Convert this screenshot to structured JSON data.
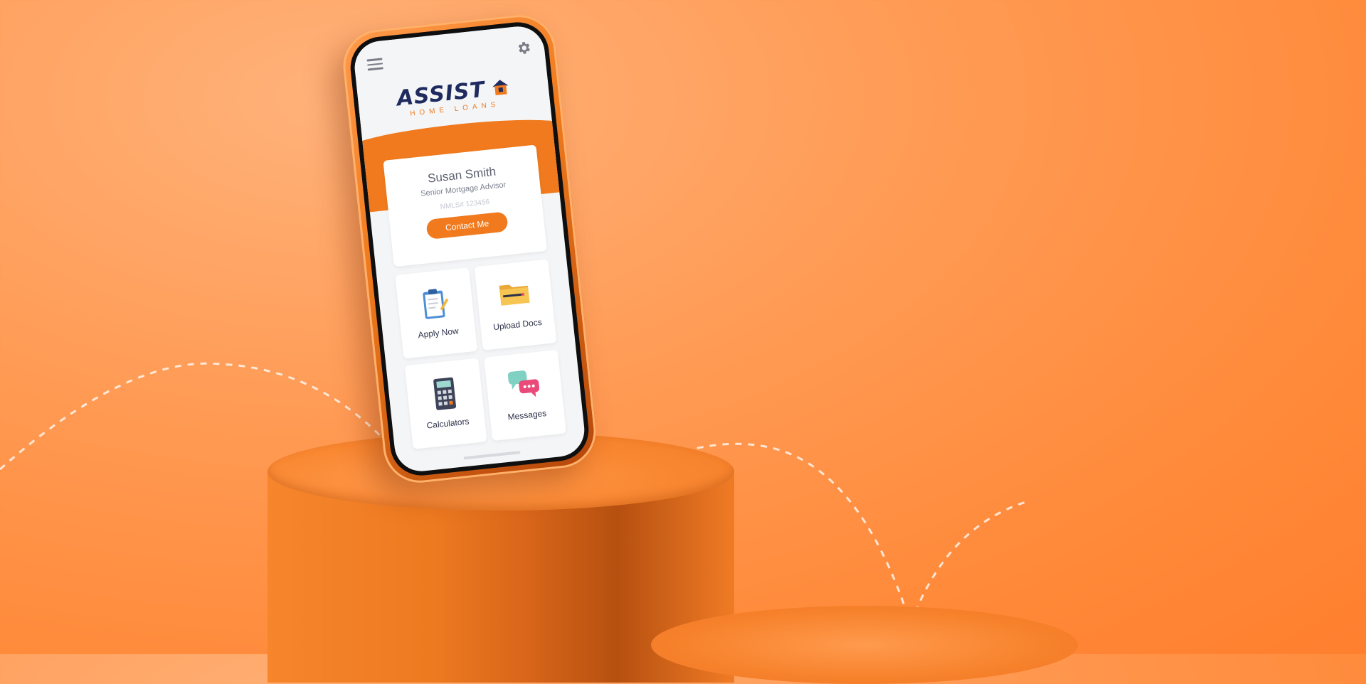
{
  "app": {
    "logo": {
      "main": "ASSIST",
      "sub": "HOME LOANS"
    },
    "icons": {
      "menu": "menu-icon",
      "settings": "gear-icon",
      "logo_house": "house-icon"
    }
  },
  "advisor": {
    "name": "Susan Smith",
    "title": "Senior Mortgage Advisor",
    "nmls": "NMLS# 123456",
    "contact_label": "Contact Me"
  },
  "tiles": [
    {
      "label": "Apply Now",
      "icon": "clipboard-icon"
    },
    {
      "label": "Upload Docs",
      "icon": "folder-icon"
    },
    {
      "label": "Calculators",
      "icon": "calculator-icon"
    },
    {
      "label": "Messages",
      "icon": "chat-bubbles-icon"
    }
  ],
  "colors": {
    "brand_orange": "#f07a1d",
    "brand_navy": "#1f2b5e",
    "background": "#ff9b55"
  }
}
